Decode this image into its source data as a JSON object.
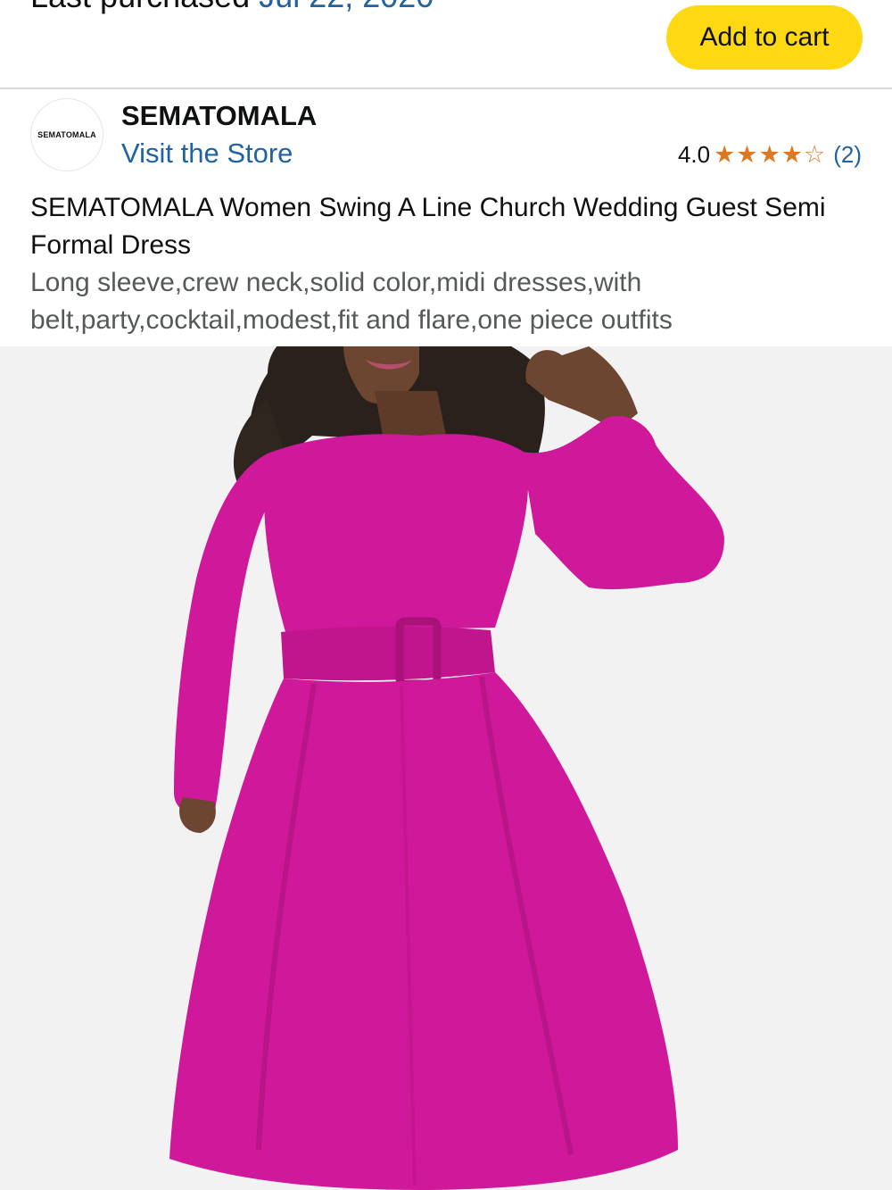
{
  "header": {
    "last_purchased_label": "Last purchased",
    "last_purchased_date": "Jul 22, 2020",
    "add_to_cart_label": "Add to cart"
  },
  "store": {
    "logo_text": "SEMATOMALA",
    "brand_name": "SEMATOMALA",
    "visit_store_label": "Visit the Store"
  },
  "rating": {
    "value": "4.0",
    "stars": 4,
    "max_stars": 5,
    "count_text": "(2)"
  },
  "product": {
    "title": "SEMATOMALA Women Swing A Line Church Wedding Guest Semi Formal Dress",
    "subtitle": "Long sleeve,crew neck,solid color,midi dresses,with belt,party,cocktail,modest,fit and flare,one piece outfits"
  },
  "image": {
    "dress_color": "#d0189a",
    "background_color": "#f2f2f2"
  },
  "colors": {
    "accent_button": "#ffd814",
    "link": "#2162a1",
    "star": "#de7921"
  }
}
